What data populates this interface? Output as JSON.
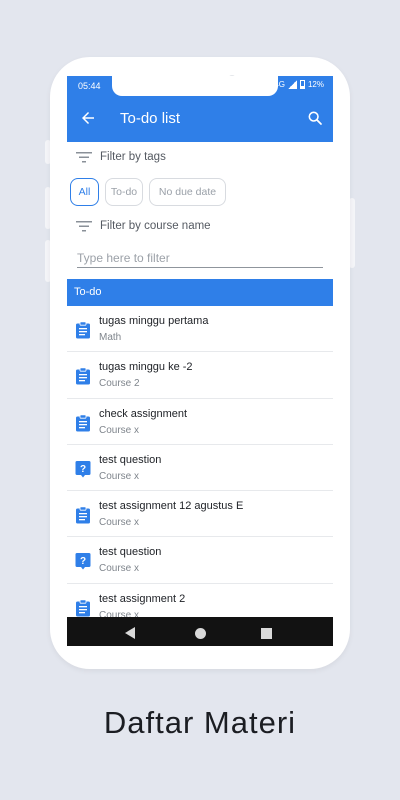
{
  "status_bar": {
    "time": "05:44",
    "network": "4G",
    "battery": "12%"
  },
  "app_bar": {
    "title": "To-do list",
    "back_icon": "arrow-left-icon",
    "search_icon": "search-icon"
  },
  "filters": {
    "tags_label": "Filter by tags",
    "tags": [
      {
        "label": "All",
        "active": true
      },
      {
        "label": "To-do",
        "active": false
      },
      {
        "label": "No due date",
        "active": false
      }
    ],
    "course_label": "Filter by course name",
    "course_input": {
      "value": "",
      "placeholder": "Type here to filter"
    }
  },
  "section": {
    "title": "To-do"
  },
  "items": [
    {
      "title": "tugas minggu pertama",
      "subtitle": "Math",
      "icon": "assignment-icon"
    },
    {
      "title": "tugas minggu ke -2",
      "subtitle": "Course 2",
      "icon": "assignment-icon"
    },
    {
      "title": "check assignment",
      "subtitle": "Course x",
      "icon": "assignment-icon"
    },
    {
      "title": "test question",
      "subtitle": "Course x",
      "icon": "question-icon"
    },
    {
      "title": "test assignment 12 agustus E",
      "subtitle": "Course x",
      "icon": "assignment-icon"
    },
    {
      "title": "test question",
      "subtitle": "Course x",
      "icon": "question-icon"
    },
    {
      "title": "test assignment 2",
      "subtitle": "Course x",
      "icon": "assignment-icon"
    }
  ],
  "caption": "Daftar Materi",
  "colors": {
    "primary": "#2f7fe8",
    "background": "#e3e6ee"
  }
}
